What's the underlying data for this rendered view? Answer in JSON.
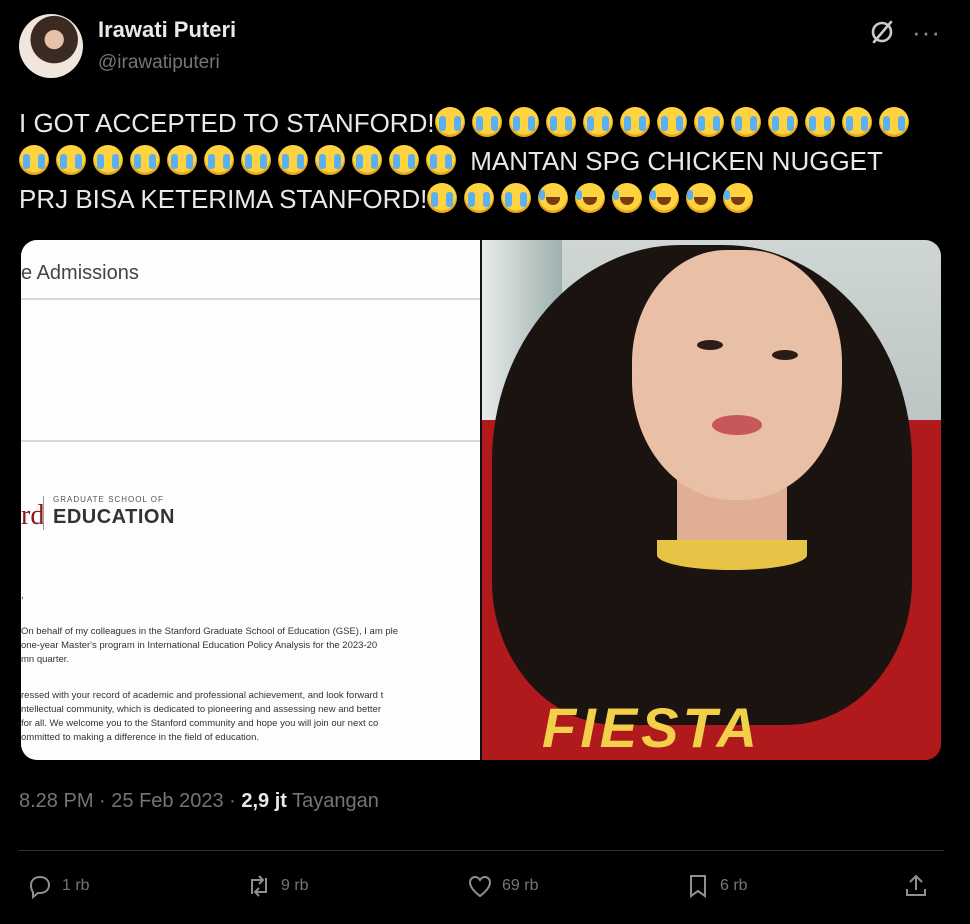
{
  "tweet": {
    "author_name": "Irawati Puteri",
    "author_handle": "@irawatiputeri",
    "text_part1": "I GOT ACCEPTED TO STANFORD!",
    "text_part2": " MANTAN SPG CHICKEN NUGGET",
    "text_part3": "PRJ BISA KETERIMA STANFORD!",
    "emoji_row1": "😭😭😭😭😭😭😭😭😭😭😭😭😭",
    "emoji_row2": "😭😭😭😭😭😭😭😭😭😭😭😭",
    "emoji_row3_cry": "😭😭😭",
    "emoji_row3_laugh": "🤣🤣🤣🤣🤣🤣",
    "time": "8.28 PM",
    "date": "25 Feb 2023",
    "views_count": "2,9 jt",
    "views_label": "Tayangan"
  },
  "media": {
    "doc_header": "e Admissions",
    "doc_logo_mark": "rd",
    "doc_logo_school": "GRADUATE SCHOOL OF",
    "doc_logo_dept": "EDUCATION",
    "doc_comma": ",",
    "doc_para1_line1": "On behalf of my colleagues in the Stanford Graduate School of Education (GSE), I am ple",
    "doc_para1_line2": "one-year Master's program in International Education Policy Analysis for the 2023-20",
    "doc_para1_line3": "mn quarter.",
    "doc_para2_line1": "ressed with your record of academic and professional achievement, and look forward t",
    "doc_para2_line2": "ntellectual community, which is dedicated to pioneering and assessing new and better",
    "doc_para2_line3": "for all. We welcome you to the Stanford community and hope you will join our next co",
    "doc_para2_line4": "ommitted to making a difference in the field of education.",
    "photo_shirt_text": "FIESTA"
  },
  "actions": {
    "reply_count": "1 rb",
    "retweet_count": "9 rb",
    "like_count": "69 rb",
    "bookmark_count": "6 rb"
  },
  "icons": {
    "grok": "grok-icon",
    "more": "more-icon",
    "reply": "reply-icon",
    "retweet": "retweet-icon",
    "like": "heart-icon",
    "bookmark": "bookmark-icon",
    "share": "share-icon"
  }
}
